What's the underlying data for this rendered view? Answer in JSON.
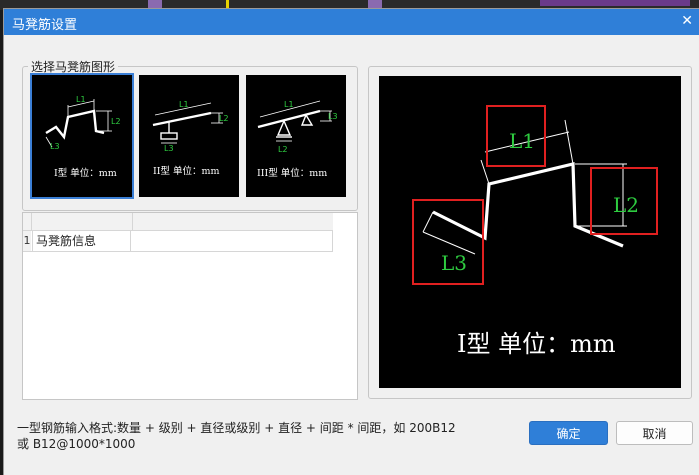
{
  "window": {
    "title": "马凳筋设置",
    "close_glyph": "✕"
  },
  "shape_group": {
    "label": "选择马凳筋图形",
    "options": [
      {
        "caption": "I型 单位：mm",
        "labels": [
          "L1",
          "L2",
          "L3"
        ],
        "selected": true
      },
      {
        "caption": "II型 单位：mm",
        "labels": [
          "L1",
          "L2",
          "L3"
        ],
        "selected": false
      },
      {
        "caption": "III型 单位：mm",
        "labels": [
          "L1",
          "L2",
          "L3"
        ],
        "selected": false
      }
    ]
  },
  "table": {
    "rows": [
      {
        "index": "1",
        "name": "马凳筋信息",
        "value": ""
      }
    ]
  },
  "preview": {
    "caption": "I型 单位：mm",
    "labels": {
      "l1": "L1",
      "l2": "L2",
      "l3": "L3"
    }
  },
  "hint": {
    "line1": "一型钢筋输入格式:数量 + 级别 + 直径或级别 + 直径 + 间距 * 间距，如 200B12",
    "line2": "或 B12@1000*1000"
  },
  "buttons": {
    "ok": "确定",
    "cancel": "取消"
  },
  "colors": {
    "title_bar": "#2f7fd8",
    "label_green": "#2ecc40",
    "highlight_red": "#e02020",
    "selection_blue": "#3b7fd6"
  }
}
